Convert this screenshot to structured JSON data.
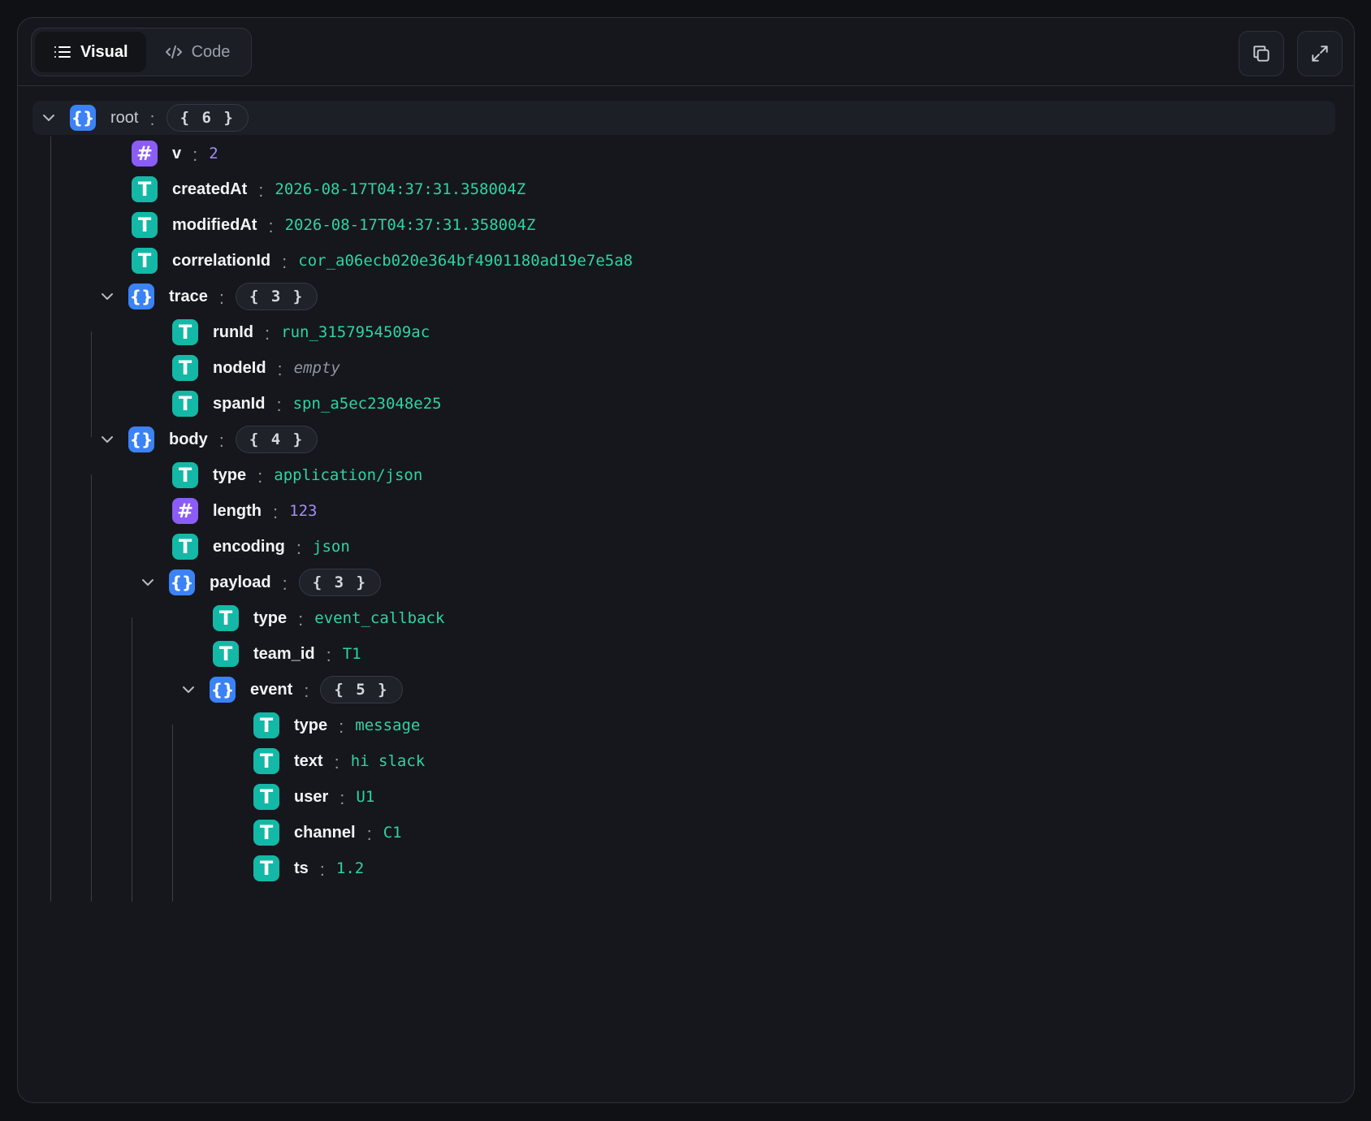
{
  "tabs": [
    {
      "label": "Visual",
      "icon": "list-icon",
      "active": true
    },
    {
      "label": "Code",
      "icon": "code-icon",
      "active": false
    }
  ],
  "toolbar": {
    "copy_icon": "copy-icon",
    "expand_icon": "expand-icon"
  },
  "colors": {
    "object": "#3b82f6",
    "string": "#14b8a6",
    "number": "#8b5cf6",
    "string_value": "#2fd3a4",
    "number_value": "#a78bfa"
  },
  "tree": {
    "root": {
      "key": "root",
      "count": "{ 6 }"
    },
    "v": {
      "key": "v",
      "value": "2"
    },
    "createdAt": {
      "key": "createdAt",
      "value": "2026-08-17T04:37:31.358004Z"
    },
    "modifiedAt": {
      "key": "modifiedAt",
      "value": "2026-08-17T04:37:31.358004Z"
    },
    "correlationId": {
      "key": "correlationId",
      "value": "cor_a06ecb020e364bf4901180ad19e7e5a8"
    },
    "trace": {
      "key": "trace",
      "count": "{ 3 }",
      "runId": {
        "key": "runId",
        "value": "run_3157954509ac"
      },
      "nodeId": {
        "key": "nodeId",
        "value": "empty"
      },
      "spanId": {
        "key": "spanId",
        "value": "spn_a5ec23048e25"
      }
    },
    "body": {
      "key": "body",
      "count": "{ 4 }",
      "type": {
        "key": "type",
        "value": "application/json"
      },
      "length": {
        "key": "length",
        "value": "123"
      },
      "encoding": {
        "key": "encoding",
        "value": "json"
      },
      "payload": {
        "key": "payload",
        "count": "{ 3 }",
        "type": {
          "key": "type",
          "value": "event_callback"
        },
        "team_id": {
          "key": "team_id",
          "value": "T1"
        },
        "event": {
          "key": "event",
          "count": "{ 5 }",
          "type": {
            "key": "type",
            "value": "message"
          },
          "text": {
            "key": "text",
            "value": "hi slack"
          },
          "user": {
            "key": "user",
            "value": "U1"
          },
          "channel": {
            "key": "channel",
            "value": "C1"
          },
          "ts": {
            "key": "ts",
            "value": "1.2"
          }
        }
      }
    }
  }
}
